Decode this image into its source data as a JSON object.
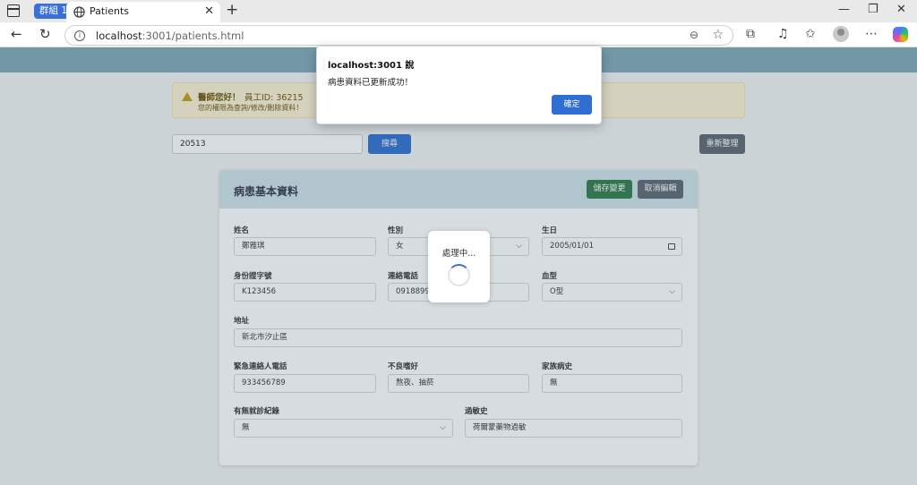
{
  "browser": {
    "tab_group_label": "群組 1",
    "tab_title": "Patients",
    "url_host": "localhost",
    "url_rest": ":3001/patients.html"
  },
  "notice": {
    "greeting": "醫師您好！",
    "staff_id": "員工ID: 36215",
    "permission": "您的權限為查詢/修改/刪除資料！"
  },
  "search": {
    "value": "20513",
    "button_label": "搜尋"
  },
  "reorganize_label": "重新整理",
  "card": {
    "title": "病患基本資料",
    "save_label": "儲存變更",
    "cancel_label": "取消編輯"
  },
  "fields": {
    "name": {
      "label": "姓名",
      "value": "鄭雅琪"
    },
    "gender": {
      "label": "性別",
      "value": "女"
    },
    "birthday": {
      "label": "生日",
      "value": "2005/01/01"
    },
    "id_number": {
      "label": "身份證字號",
      "value": "K123456"
    },
    "phone": {
      "label": "連絡電話",
      "value": "0918899000"
    },
    "blood_type": {
      "label": "血型",
      "value": "O型"
    },
    "address": {
      "label": "地址",
      "value": "新北市汐止區"
    },
    "emergency_phone": {
      "label": "緊急連絡人電話",
      "value": "933456789"
    },
    "bad_habits": {
      "label": "不良嗜好",
      "value": "熬夜、抽菸"
    },
    "family_history": {
      "label": "家族病史",
      "value": "無"
    },
    "visit_record": {
      "label": "有無就診紀錄",
      "value": "無"
    },
    "allergy": {
      "label": "過敏史",
      "value": "荷爾蒙藥物過敏"
    }
  },
  "loader": {
    "text": "處理中..."
  },
  "dialog": {
    "title": "localhost:3001 說",
    "message": "病患資料已更新成功！",
    "ok_label": "確定"
  },
  "colors": {
    "header": "#7fa8b8",
    "primary": "#2f6fd1",
    "save": "#2d7a44",
    "secondary": "#5d6670"
  }
}
